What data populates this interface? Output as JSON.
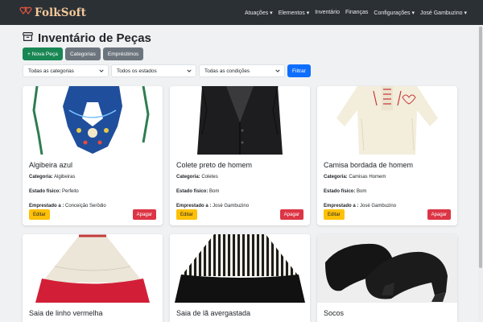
{
  "brand": {
    "name": "FolkSoft"
  },
  "nav": {
    "items": [
      {
        "label": "Atuações",
        "dropdown": true
      },
      {
        "label": "Elementos",
        "dropdown": true
      },
      {
        "label": "Inventário",
        "dropdown": false
      },
      {
        "label": "Finanças",
        "dropdown": false
      },
      {
        "label": "Configurações",
        "dropdown": true
      },
      {
        "label": "José Gambuzino",
        "dropdown": true
      }
    ]
  },
  "page": {
    "title": "Inventário de Peças",
    "buttons": {
      "new_piece": "+ Nova Peça",
      "categories": "Categorias",
      "loans": "Empréstimos"
    }
  },
  "filters": {
    "category": "Todas as categorias",
    "state": "Todos os estados",
    "condition": "Todas as condições",
    "submit": "Filtrar"
  },
  "labels": {
    "category": "Categoria:",
    "physical_state": "Estado físico:",
    "loaned_to": "Emprestado a :",
    "edit": "Editar",
    "delete": "Apagar"
  },
  "cards": [
    {
      "title": "Algibeira azul",
      "category": "Algibeiras",
      "state": "Perfeito",
      "loaned_to": "Conceição Serôdio"
    },
    {
      "title": "Colete preto de homem",
      "category": "Coletes",
      "state": "Bom",
      "loaned_to": "José Gambuzino"
    },
    {
      "title": "Camisa bordada de homem",
      "category": "Camisas Homem",
      "state": "Bom",
      "loaned_to": "José Gambuzino"
    },
    {
      "title": "Saia de linho vermelha"
    },
    {
      "title": "Saia de lã avergastada"
    },
    {
      "title": "Socos"
    }
  ],
  "colors": {
    "navbar": "#2b3035",
    "brand": "#f5c99a",
    "primary": "#0d6efd",
    "success": "#198754",
    "secondary": "#6c757d",
    "warning": "#ffc107",
    "danger": "#dc3545"
  }
}
